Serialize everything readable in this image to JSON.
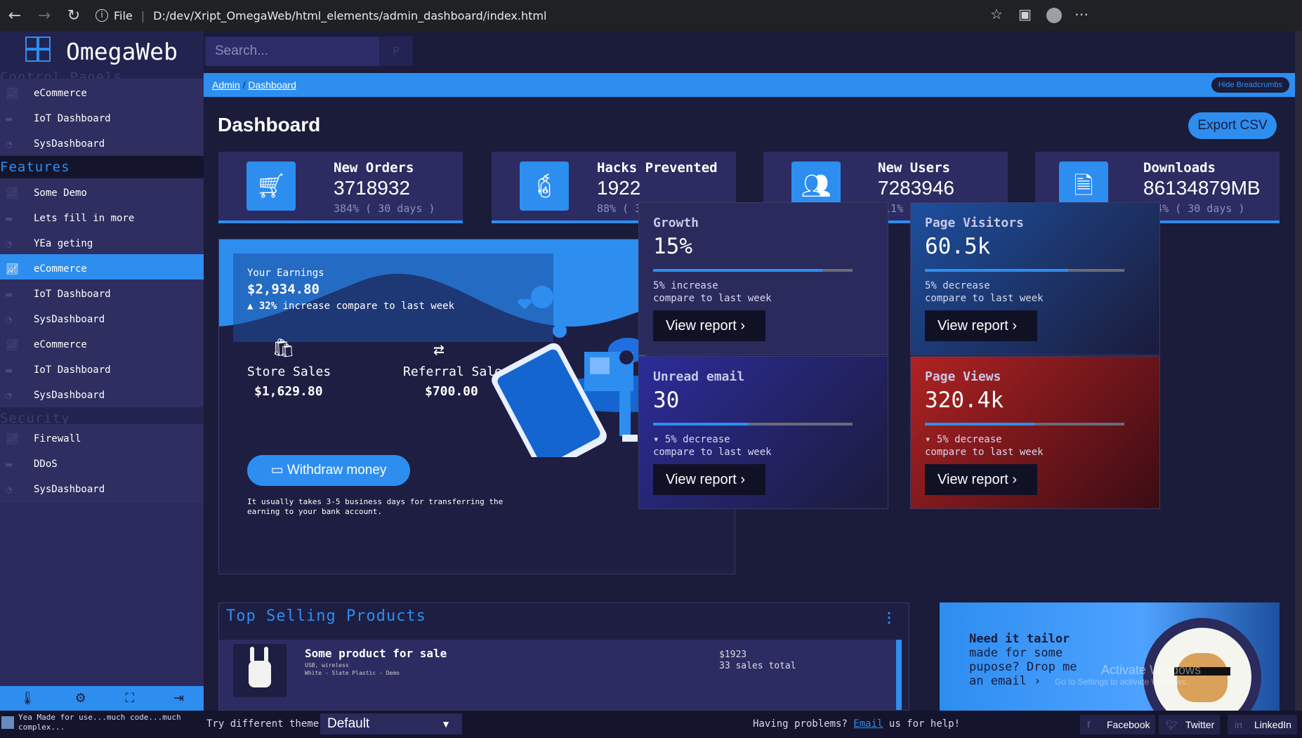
{
  "browser": {
    "back_icon": "←",
    "forward_icon": "→",
    "reload_icon": "↻",
    "info_label": "File",
    "url": "D:/dev/Xript_OmegaWeb/html_elements/admin_dashboard/index.html"
  },
  "brand": {
    "name": "OmegaWeb"
  },
  "search": {
    "placeholder": "Search...",
    "button_glyph": "P"
  },
  "sidebar": {
    "sections": [
      {
        "title": "Control Panels",
        "items": [
          "eCommerce",
          "IoT Dashboard",
          "SysDashboard"
        ]
      },
      {
        "title": "Features",
        "items": [
          "Some Demo",
          "Lets fill in more",
          "YEa geting",
          "eCommerce",
          "IoT Dashboard",
          "SysDashboard",
          "eCommerce",
          "IoT Dashboard",
          "SysDashboard"
        ]
      },
      {
        "title": "Security",
        "items": [
          "Firewall",
          "DDoS",
          "SysDashboard"
        ]
      }
    ],
    "selected": "eCommerce"
  },
  "breadcrumb": {
    "root": "Admin",
    "sep": "/",
    "current": "Dashboard",
    "hide_label": "Hide Breadcrumbs"
  },
  "page": {
    "title": "Dashboard",
    "export_label": "Export CSV"
  },
  "stats": [
    {
      "label": "New Orders",
      "value": "3718932",
      "sub": "384% ( 30 days )"
    },
    {
      "label": "Hacks Prevented",
      "value": "1922",
      "sub": "88% ( 30 days )"
    },
    {
      "label": "New Users",
      "value": "7283946",
      "sub": "211% ( 30 days )"
    },
    {
      "label": "Downloads",
      "value": "86134879MB",
      "sub": "444% ( 30 days )"
    }
  ],
  "earnings": {
    "label": "Your Earnings",
    "amount": "$2,934.80",
    "pct": "32%",
    "pct_text": "increase compare to last week",
    "store_label": "Store Sales",
    "store_value": "$1,629.80",
    "referral_label": "Referral Sales",
    "referral_value": "$700.00",
    "withdraw_label": "Withdraw money",
    "note_line1": "It usually takes 3-5 business days for transferring the",
    "note_line2": "earning to your bank account."
  },
  "metric_cards": [
    {
      "title": "Growth",
      "value": "15%",
      "line1": "5% increase",
      "line2": "compare to last week",
      "button": "View report",
      "progress": 0.85
    },
    {
      "title": "Page Visitors",
      "value": "60.5k",
      "line1": "5% decrease",
      "line2": "compare to last week",
      "button": "View report",
      "progress": 0.72
    },
    {
      "title": "Unread email",
      "value": "30",
      "line1": "5% decrease",
      "line2": "compare to last week",
      "button": "View report",
      "progress": 0.48
    },
    {
      "title": "Page Views",
      "value": "320.4k",
      "line1": "5% decrease",
      "line2": "compare to last week",
      "button": "View report",
      "progress": 0.55
    }
  ],
  "top_selling": {
    "title": "Top Selling Products",
    "product": {
      "name": "Some product for sale",
      "meta1": "USB, wireless",
      "meta2": "White - Slate Plastic - Demo",
      "price": "$1923",
      "sales": "33 sales total"
    }
  },
  "promo": {
    "line1": "Need it tailor",
    "line2": "made for some",
    "line3": "pupose? Drop me",
    "line4": "an email",
    "watermark1": "Activate Windows",
    "watermark2": "Go to Settings to activate Windows."
  },
  "footer": {
    "made_line1": "Yea Made for use...much code...much",
    "made_line2": "complex...",
    "theme_label": "Try different theme:",
    "theme_value": "Default",
    "help_pre": "Having problems?",
    "help_link": "Email",
    "help_post": "us for help!",
    "social": [
      "Facebook",
      "Twitter",
      "LinkedIn"
    ]
  },
  "colors": {
    "accent": "#2d8ef0",
    "sidebar": "#2a2a5c",
    "main_bg": "#1b1b3a",
    "card": "#2c2c62"
  }
}
